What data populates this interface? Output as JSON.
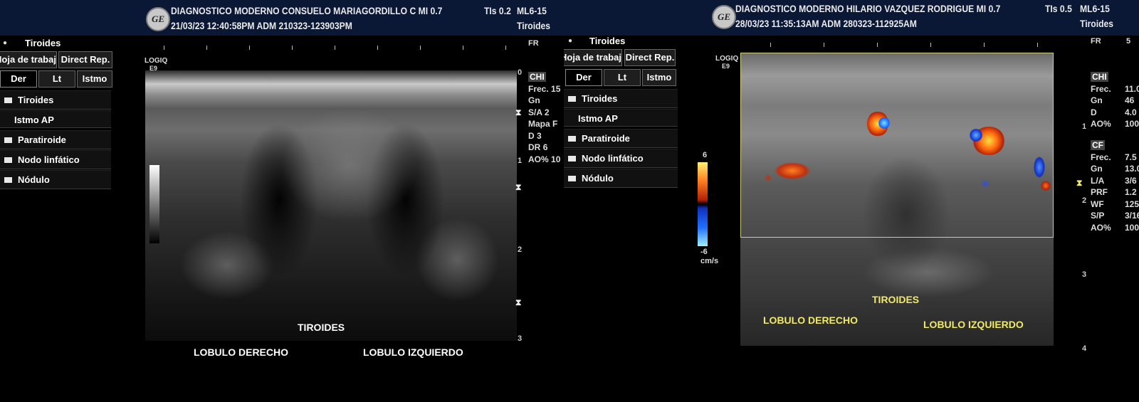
{
  "left": {
    "header": {
      "logo": "GE",
      "line1": "DIAGNOSTICO MODERNO CONSUELO MARIAGORDILLO C MI 0.7",
      "tis": "TIs 0.2",
      "probe": "ML6-15",
      "line2": "21/03/23 12:40:58PM  ADM  210323-123903PM",
      "preset": "Tiroides"
    },
    "menu": {
      "title": "Tiroides",
      "worksheet": "Hoja de trabajo",
      "direct_rep": "Direct Rep.",
      "tabs": [
        "Der",
        "Lt",
        "Istmo"
      ],
      "items": [
        "Tiroides",
        "Istmo AP",
        "Paratiroide",
        "Nodo linfático",
        "Nódulo"
      ]
    },
    "machine": {
      "name": "LOGIQ",
      "model": "E9"
    },
    "fr_label": "FR",
    "params": [
      {
        "k": "CHI",
        "v": ""
      },
      {
        "k": "Frec.",
        "v": "15"
      },
      {
        "k": "Gn",
        "v": ""
      },
      {
        "k": "S/A",
        "v": "2"
      },
      {
        "k": "Mapa",
        "v": "F"
      },
      {
        "k": "D",
        "v": "3"
      },
      {
        "k": "DR",
        "v": "6"
      },
      {
        "k": "AO%",
        "v": "10"
      }
    ],
    "depth_ticks": [
      "0",
      "1",
      "2",
      "3"
    ],
    "labels": {
      "tiroides": "TIROIDES",
      "der": "LOBULO DERECHO",
      "izq": "LOBULO IZQUIERDO"
    }
  },
  "right": {
    "header": {
      "logo": "GE",
      "line1": "DIAGNOSTICO MODERNO HILARIO VAZQUEZ  RODRIGUE MI 0.7",
      "tis": "TIs 0.5",
      "probe": "ML6-15",
      "line2": "28/03/23 11:35:13AM  ADM  280323-112925AM",
      "preset": "Tiroides"
    },
    "menu": {
      "title": "Tiroides",
      "worksheet": "Hoja de trabajo",
      "direct_rep": "Direct Rep.",
      "tabs": [
        "Der",
        "Lt",
        "Istmo"
      ],
      "items": [
        "Tiroides",
        "Istmo AP",
        "Paratiroide",
        "Nodo linfático",
        "Nódulo"
      ]
    },
    "machine": {
      "name": "LOGIQ",
      "model": "E9"
    },
    "fr_label": "FR",
    "fr_value": "5",
    "color_scale": {
      "max": "6",
      "min": "-6",
      "unit": "cm/s"
    },
    "params_chi": [
      {
        "k": "CHI",
        "v": ""
      },
      {
        "k": "Frec.",
        "v": "11.0"
      },
      {
        "k": "Gn",
        "v": "46"
      },
      {
        "k": "D",
        "v": "4.0"
      },
      {
        "k": "AO%",
        "v": "100"
      }
    ],
    "params_cf": [
      {
        "k": "CF",
        "v": ""
      },
      {
        "k": "Frec.",
        "v": "7.5"
      },
      {
        "k": "Gn",
        "v": "13.0"
      },
      {
        "k": "L/A",
        "v": "3/6"
      },
      {
        "k": "PRF",
        "v": "1.2"
      },
      {
        "k": "WF",
        "v": "125"
      },
      {
        "k": "S/P",
        "v": "3/16"
      },
      {
        "k": "AO%",
        "v": "100"
      }
    ],
    "depth_ticks": [
      "1",
      "2",
      "3",
      "4"
    ],
    "labels": {
      "tiroides": "TIROIDES",
      "der": "LOBULO DERECHO",
      "izq": "LOBULO IZQUIERDO"
    }
  }
}
